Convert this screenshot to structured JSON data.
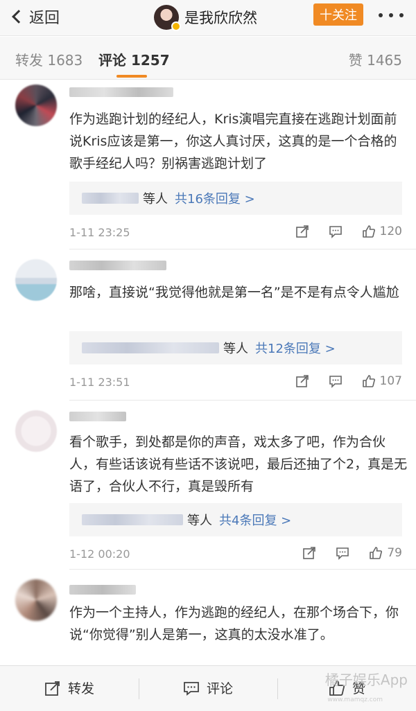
{
  "nav": {
    "back_label": "返回",
    "title": "是我欣欣然",
    "follow_label": "十关注"
  },
  "tabs": {
    "repost": "转发 1683",
    "comment": "评论 1257",
    "like": "赞 1465"
  },
  "comments": [
    {
      "text": "作为逃跑计划的经纪人，Kris演唱完直接在逃跑计划面前说Kris应该是第一，你这人真讨厌，这真的是一个合格的歌手经纪人吗？别祸害逃跑计划了",
      "reply_who": "等人",
      "reply_count": "共16条回复 >",
      "time": "1-11 23:25",
      "likes": "120"
    },
    {
      "text": "那啥，直接说“我觉得他就是第一名”是不是有点令人尴尬",
      "reply_who": "等人",
      "reply_count": "共12条回复 >",
      "time": "1-11 23:51",
      "likes": "107"
    },
    {
      "text": "看个歌手，到处都是你的声音，戏太多了吧，作为合伙人，有些话该说有些话不该说吧，最后还抽了个2，真是无语了，合伙人不行，真是毁所有",
      "reply_who": "等人",
      "reply_count": "共4条回复 >",
      "time": "1-12 00:20",
      "likes": "79"
    },
    {
      "text": "作为一个主持人，作为逃跑的经纪人，在那个场合下，你说“你觉得”别人是第一，这真的太没水准了。"
    }
  ],
  "toolbar": {
    "repost": "转发",
    "comment": "评论",
    "like": "赞"
  },
  "watermark": "橘子娱乐App",
  "watermark_sub": "www.mamqz.com",
  "colors": {
    "accent": "#f08a24",
    "link": "#4a78b8"
  }
}
